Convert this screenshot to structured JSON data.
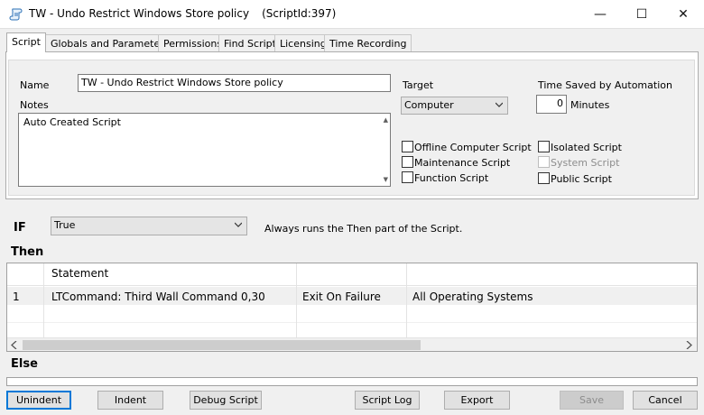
{
  "window": {
    "title": "TW - Undo Restrict Windows Store policy",
    "script_id": "(ScriptId:397)",
    "minimize_glyph": "—",
    "maximize_glyph": "☐",
    "close_glyph": "✕"
  },
  "tabs": [
    {
      "label": "Script",
      "active": true
    },
    {
      "label": "Globals and Parameters"
    },
    {
      "label": "Permissions"
    },
    {
      "label": "Find Script"
    },
    {
      "label": "Licensing"
    },
    {
      "label": "Time Recording"
    }
  ],
  "form": {
    "name_label": "Name",
    "name_value": "TW - Undo Restrict Windows Store policy",
    "notes_label": "Notes",
    "notes_value": "Auto Created Script",
    "target_label": "Target",
    "target_value": "Computer",
    "time_saved_label": "Time Saved by Automation",
    "time_saved_value": "0",
    "minutes_label": "Minutes"
  },
  "checkboxes": {
    "offline": {
      "label": "Offline Computer Script",
      "checked": false
    },
    "maintenance": {
      "label": "Maintenance Script",
      "checked": false
    },
    "function": {
      "label": "Function Script",
      "checked": false
    },
    "isolated": {
      "label": "Isolated Script",
      "checked": false
    },
    "system": {
      "label": "System Script",
      "checked": false,
      "disabled": true
    },
    "public": {
      "label": "Public Script",
      "checked": false
    }
  },
  "if_section": {
    "label": "IF",
    "condition": "True",
    "description": "Always runs the Then part of the Script."
  },
  "then_section": {
    "label": "Then",
    "columns": [
      "",
      "Statement",
      "",
      ""
    ],
    "rows": [
      {
        "num": "1",
        "statement": "LTCommand: Third Wall Command 0,30",
        "on_failure": "Exit On Failure",
        "os": "All Operating Systems"
      }
    ]
  },
  "else_section": {
    "label": "Else"
  },
  "buttons": {
    "unindent": "Unindent",
    "indent": "Indent",
    "debug": "Debug Script",
    "script_log": "Script Log",
    "export": "Export",
    "save": "Save",
    "cancel": "Cancel"
  },
  "colors": {
    "accent": "#0078d7",
    "row_highlight": "#f0f0f0"
  }
}
